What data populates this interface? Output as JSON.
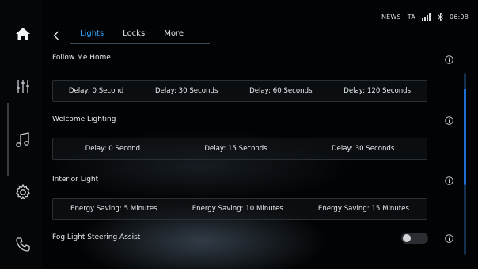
{
  "status_bar": {
    "source": "NEWS",
    "ta": "TA",
    "time": "06:08",
    "icons": [
      "signal-icon",
      "bluetooth-icon"
    ]
  },
  "sidebar": {
    "items": [
      {
        "name": "home",
        "icon": "home-icon"
      },
      {
        "name": "audio-settings",
        "icon": "equalizer-icon"
      },
      {
        "name": "media",
        "icon": "music-note-icon"
      },
      {
        "name": "settings",
        "icon": "gear-icon"
      },
      {
        "name": "phone",
        "icon": "phone-icon"
      }
    ]
  },
  "header": {
    "back_icon": "chevron-left-icon",
    "tabs": [
      {
        "label": "Lights",
        "active": true
      },
      {
        "label": "Locks",
        "active": false
      },
      {
        "label": "More",
        "active": false
      }
    ]
  },
  "sections": {
    "follow_me_home": {
      "title": "Follow Me Home",
      "options": [
        "Delay: 0 Second",
        "Delay: 30 Seconds",
        "Delay: 60 Seconds",
        "Delay: 120 Seconds"
      ]
    },
    "welcome_lighting": {
      "title": "Welcome Lighting",
      "options": [
        "Delay: 0 Second",
        "Delay: 15 Seconds",
        "Delay: 30 Seconds"
      ]
    },
    "interior_light": {
      "title": "Interior Light",
      "options": [
        "Energy Saving: 5 Minutes",
        "Energy Saving: 10 Minutes",
        "Energy Saving: 15 Minutes"
      ]
    },
    "fog_light": {
      "title": "Fog Light Steering Assist",
      "toggle_on": false
    }
  },
  "colors": {
    "accent": "#2ea7ff",
    "background": "#020304",
    "text": "#e9eef4"
  }
}
